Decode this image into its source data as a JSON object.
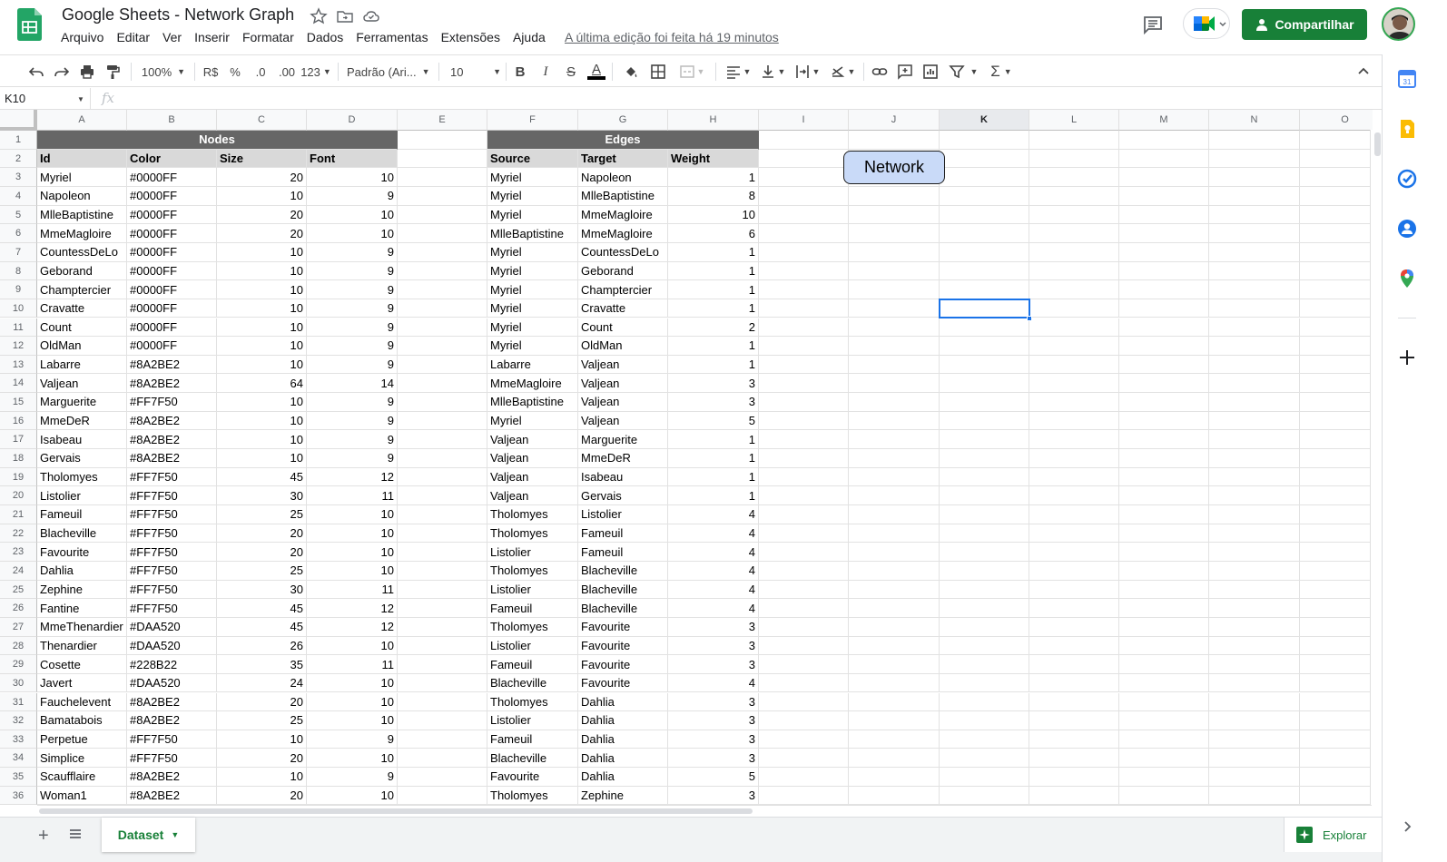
{
  "header": {
    "title": "Google Sheets - Network Graph",
    "menu": [
      "Arquivo",
      "Editar",
      "Ver",
      "Inserir",
      "Formatar",
      "Dados",
      "Ferramentas",
      "Extensões",
      "Ajuda"
    ],
    "last_edit": "A última edição foi feita há 19 minutos",
    "share_label": "Compartilhar"
  },
  "toolbar": {
    "zoom": "100%",
    "currency": "R$",
    "percent": "%",
    "decrease_decimals": ".0",
    "increase_decimals": ".00",
    "more_formats": "123",
    "font": "Padrão (Ari...",
    "font_size": "10",
    "bold": "B",
    "italic": "I",
    "strike": "S",
    "text_color": "A"
  },
  "formula_bar": {
    "cell_ref": "K10",
    "fx": "fx",
    "content": ""
  },
  "grid": {
    "columns": [
      "A",
      "B",
      "C",
      "D",
      "E",
      "F",
      "G",
      "H",
      "I",
      "J",
      "K",
      "L",
      "M",
      "N",
      "O"
    ],
    "selected_column": "K",
    "rows": [
      "1",
      "2",
      "3",
      "4",
      "5",
      "6",
      "7",
      "8",
      "9",
      "10",
      "11",
      "12",
      "13",
      "14",
      "15",
      "16",
      "17",
      "18",
      "19",
      "20",
      "21",
      "22",
      "23",
      "24",
      "25",
      "26",
      "27",
      "28",
      "29",
      "30",
      "31",
      "32",
      "33",
      "34",
      "35",
      "36"
    ],
    "nodes_title": "Nodes",
    "edges_title": "Edges",
    "nodes_headers": [
      "Id",
      "Color",
      "Size",
      "Font"
    ],
    "edges_headers": [
      "Source",
      "Target",
      "Weight"
    ],
    "nodes": [
      [
        "Myriel",
        "#0000FF",
        "20",
        "10"
      ],
      [
        "Napoleon",
        "#0000FF",
        "10",
        "9"
      ],
      [
        "MlleBaptistine",
        "#0000FF",
        "20",
        "10"
      ],
      [
        "MmeMagloire",
        "#0000FF",
        "20",
        "10"
      ],
      [
        "CountessDeLo",
        "#0000FF",
        "10",
        "9"
      ],
      [
        "Geborand",
        "#0000FF",
        "10",
        "9"
      ],
      [
        "Champtercier",
        "#0000FF",
        "10",
        "9"
      ],
      [
        "Cravatte",
        "#0000FF",
        "10",
        "9"
      ],
      [
        "Count",
        "#0000FF",
        "10",
        "9"
      ],
      [
        "OldMan",
        "#0000FF",
        "10",
        "9"
      ],
      [
        "Labarre",
        "#8A2BE2",
        "10",
        "9"
      ],
      [
        "Valjean",
        "#8A2BE2",
        "64",
        "14"
      ],
      [
        "Marguerite",
        "#FF7F50",
        "10",
        "9"
      ],
      [
        "MmeDeR",
        "#8A2BE2",
        "10",
        "9"
      ],
      [
        "Isabeau",
        "#8A2BE2",
        "10",
        "9"
      ],
      [
        "Gervais",
        "#8A2BE2",
        "10",
        "9"
      ],
      [
        "Tholomyes",
        "#FF7F50",
        "45",
        "12"
      ],
      [
        "Listolier",
        "#FF7F50",
        "30",
        "11"
      ],
      [
        "Fameuil",
        "#FF7F50",
        "25",
        "10"
      ],
      [
        "Blacheville",
        "#FF7F50",
        "20",
        "10"
      ],
      [
        "Favourite",
        "#FF7F50",
        "20",
        "10"
      ],
      [
        "Dahlia",
        "#FF7F50",
        "25",
        "10"
      ],
      [
        "Zephine",
        "#FF7F50",
        "30",
        "11"
      ],
      [
        "Fantine",
        "#FF7F50",
        "45",
        "12"
      ],
      [
        "MmeThenardier",
        "#DAA520",
        "45",
        "12"
      ],
      [
        "Thenardier",
        "#DAA520",
        "26",
        "10"
      ],
      [
        "Cosette",
        "#228B22",
        "35",
        "11"
      ],
      [
        "Javert",
        "#DAA520",
        "24",
        "10"
      ],
      [
        "Fauchelevent",
        "#8A2BE2",
        "20",
        "10"
      ],
      [
        "Bamatabois",
        "#8A2BE2",
        "25",
        "10"
      ],
      [
        "Perpetue",
        "#FF7F50",
        "10",
        "9"
      ],
      [
        "Simplice",
        "#FF7F50",
        "20",
        "10"
      ],
      [
        "Scaufflaire",
        "#8A2BE2",
        "10",
        "9"
      ],
      [
        "Woman1",
        "#8A2BE2",
        "20",
        "10"
      ]
    ],
    "edges": [
      [
        "Myriel",
        "Napoleon",
        "1"
      ],
      [
        "Myriel",
        "MlleBaptistine",
        "8"
      ],
      [
        "Myriel",
        "MmeMagloire",
        "10"
      ],
      [
        "MlleBaptistine",
        "MmeMagloire",
        "6"
      ],
      [
        "Myriel",
        "CountessDeLo",
        "1"
      ],
      [
        "Myriel",
        "Geborand",
        "1"
      ],
      [
        "Myriel",
        "Champtercier",
        "1"
      ],
      [
        "Myriel",
        "Cravatte",
        "1"
      ],
      [
        "Myriel",
        "Count",
        "2"
      ],
      [
        "Myriel",
        "OldMan",
        "1"
      ],
      [
        "Labarre",
        "Valjean",
        "1"
      ],
      [
        "MmeMagloire",
        "Valjean",
        "3"
      ],
      [
        "MlleBaptistine",
        "Valjean",
        "3"
      ],
      [
        "Myriel",
        "Valjean",
        "5"
      ],
      [
        "Valjean",
        "Marguerite",
        "1"
      ],
      [
        "Valjean",
        "MmeDeR",
        "1"
      ],
      [
        "Valjean",
        "Isabeau",
        "1"
      ],
      [
        "Valjean",
        "Gervais",
        "1"
      ],
      [
        "Tholomyes",
        "Listolier",
        "4"
      ],
      [
        "Tholomyes",
        "Fameuil",
        "4"
      ],
      [
        "Listolier",
        "Fameuil",
        "4"
      ],
      [
        "Tholomyes",
        "Blacheville",
        "4"
      ],
      [
        "Listolier",
        "Blacheville",
        "4"
      ],
      [
        "Fameuil",
        "Blacheville",
        "4"
      ],
      [
        "Tholomyes",
        "Favourite",
        "3"
      ],
      [
        "Listolier",
        "Favourite",
        "3"
      ],
      [
        "Fameuil",
        "Favourite",
        "3"
      ],
      [
        "Blacheville",
        "Favourite",
        "4"
      ],
      [
        "Tholomyes",
        "Dahlia",
        "3"
      ],
      [
        "Listolier",
        "Dahlia",
        "3"
      ],
      [
        "Fameuil",
        "Dahlia",
        "3"
      ],
      [
        "Blacheville",
        "Dahlia",
        "3"
      ],
      [
        "Favourite",
        "Dahlia",
        "5"
      ],
      [
        "Tholomyes",
        "Zephine",
        "3"
      ]
    ],
    "network_button": "Network"
  },
  "bottom": {
    "sheet_tab": "Dataset",
    "explore": "Explorar"
  },
  "colors": {
    "brand_green": "#188038",
    "header_dark": "#666666",
    "header_light": "#d9d9d9",
    "button_fill": "#c9daf8",
    "selection": "#1a73e8"
  },
  "side_panel": {
    "icons": [
      "calendar-icon",
      "keep-icon",
      "tasks-icon",
      "contacts-icon",
      "maps-icon",
      "add-icon"
    ]
  }
}
